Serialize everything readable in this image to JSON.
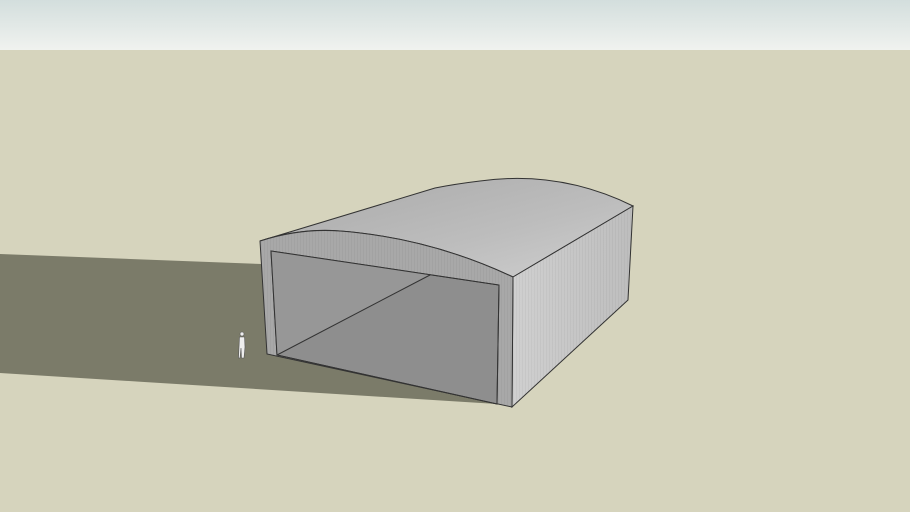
{
  "scene": {
    "subject": "hangar",
    "colors": {
      "sky_top": "#d3dedd",
      "sky_bottom": "#f0f2ef",
      "ground": "#d6d4bd",
      "shadow": "#7b7b69",
      "roof": "#b4b4b4",
      "front_wall": "#a6a6a6",
      "side_wall": "#c9c9c9",
      "interior": "#8c8c8c",
      "edge": "#333333"
    }
  }
}
